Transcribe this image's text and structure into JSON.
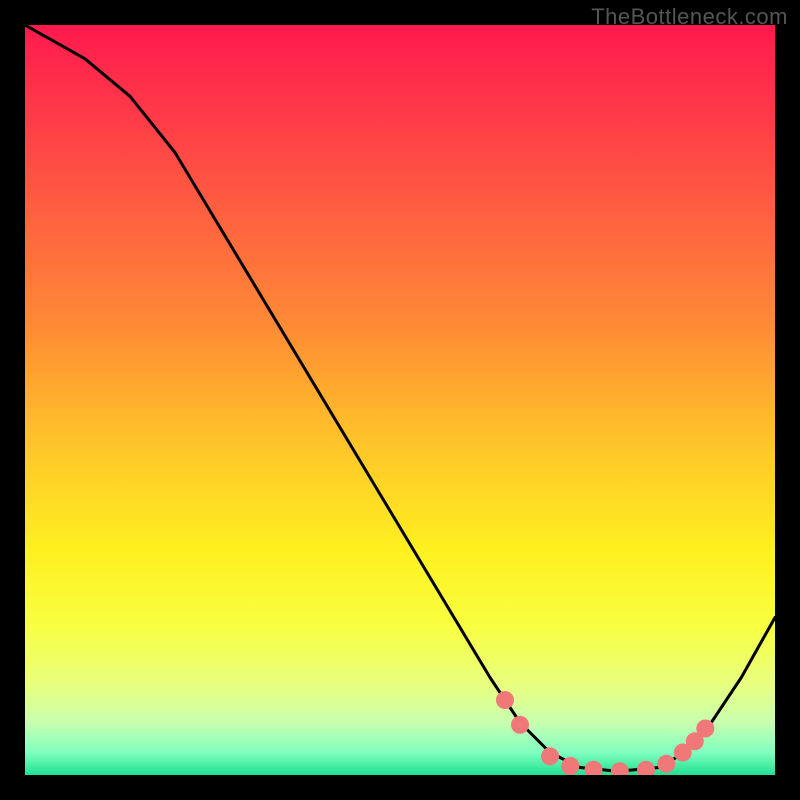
{
  "watermark": "TheBottleneck.com",
  "gradient_stops": [
    {
      "offset": 0.0,
      "color": "#ff1a4d"
    },
    {
      "offset": 0.12,
      "color": "#ff3a48"
    },
    {
      "offset": 0.25,
      "color": "#ff6040"
    },
    {
      "offset": 0.4,
      "color": "#ff8a35"
    },
    {
      "offset": 0.55,
      "color": "#ffc22a"
    },
    {
      "offset": 0.7,
      "color": "#fff020"
    },
    {
      "offset": 0.8,
      "color": "#f8ff40"
    },
    {
      "offset": 0.88,
      "color": "#e8ff80"
    },
    {
      "offset": 0.93,
      "color": "#c8ffb0"
    },
    {
      "offset": 0.97,
      "color": "#80ffc0"
    },
    {
      "offset": 1.0,
      "color": "#20e090"
    }
  ],
  "curve_points_norm": [
    [
      0.0,
      0.0
    ],
    [
      0.08,
      0.045
    ],
    [
      0.14,
      0.095
    ],
    [
      0.2,
      0.17
    ],
    [
      0.26,
      0.27
    ],
    [
      0.32,
      0.37
    ],
    [
      0.38,
      0.47
    ],
    [
      0.44,
      0.57
    ],
    [
      0.5,
      0.67
    ],
    [
      0.56,
      0.77
    ],
    [
      0.62,
      0.87
    ],
    [
      0.66,
      0.93
    ],
    [
      0.7,
      0.97
    ],
    [
      0.74,
      0.99
    ],
    [
      0.79,
      0.995
    ],
    [
      0.845,
      0.99
    ],
    [
      0.88,
      0.97
    ],
    [
      0.915,
      0.93
    ],
    [
      0.955,
      0.87
    ],
    [
      1.0,
      0.79
    ]
  ],
  "bead_points_norm": [
    [
      0.64,
      0.9
    ],
    [
      0.66,
      0.933
    ],
    [
      0.7,
      0.975
    ],
    [
      0.727,
      0.988
    ],
    [
      0.758,
      0.993
    ],
    [
      0.793,
      0.995
    ],
    [
      0.828,
      0.993
    ],
    [
      0.855,
      0.985
    ],
    [
      0.877,
      0.97
    ],
    [
      0.893,
      0.955
    ],
    [
      0.907,
      0.938
    ]
  ],
  "chart_data": {
    "type": "line",
    "title": "",
    "xlabel": "",
    "ylabel": "",
    "xlim": [
      0,
      1
    ],
    "ylim": [
      0,
      1
    ],
    "x": [
      0.0,
      0.08,
      0.14,
      0.2,
      0.26,
      0.32,
      0.38,
      0.44,
      0.5,
      0.56,
      0.62,
      0.66,
      0.7,
      0.74,
      0.79,
      0.845,
      0.88,
      0.915,
      0.955,
      1.0
    ],
    "values": [
      1.0,
      0.955,
      0.905,
      0.83,
      0.73,
      0.63,
      0.53,
      0.43,
      0.33,
      0.23,
      0.13,
      0.07,
      0.03,
      0.01,
      0.005,
      0.01,
      0.03,
      0.07,
      0.13,
      0.21
    ],
    "markers": {
      "x": [
        0.64,
        0.66,
        0.7,
        0.727,
        0.758,
        0.793,
        0.828,
        0.855,
        0.877,
        0.893,
        0.907
      ],
      "values": [
        0.1,
        0.067,
        0.025,
        0.012,
        0.007,
        0.005,
        0.007,
        0.015,
        0.03,
        0.045,
        0.062
      ]
    },
    "grid": false,
    "legend": false
  }
}
